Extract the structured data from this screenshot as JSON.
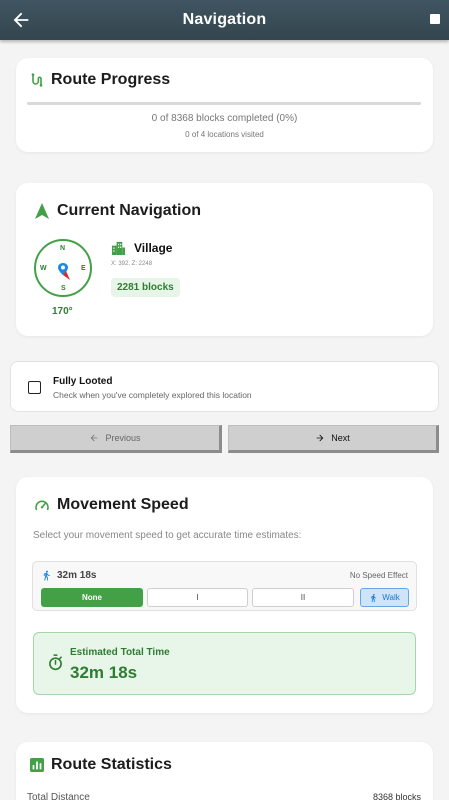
{
  "appbar": {
    "title": "Navigation"
  },
  "route_progress": {
    "title": "Route Progress",
    "progress_fraction": 0.0,
    "blocks_text": "0 of 8368 blocks completed (0%)",
    "locations_text": "0 of 4 locations visited"
  },
  "current_navigation": {
    "title": "Current Navigation",
    "compass": {
      "n": "N",
      "s": "S",
      "e": "E",
      "w": "W"
    },
    "heading": "170°",
    "location_name": "Village",
    "coords": "X: 392, Z: 2248",
    "distance": "2281 blocks"
  },
  "looted": {
    "title": "Fully Looted",
    "subtitle": "Check when you've completely explored this location",
    "checked": false
  },
  "nav_buttons": {
    "previous": "Previous",
    "next": "Next"
  },
  "movement_speed": {
    "title": "Movement Speed",
    "subtitle": "Select your movement speed to get accurate time estimates:",
    "time": "32m 18s",
    "effect": "No Speed Effect",
    "options": [
      "None",
      "I",
      "II"
    ],
    "walk_label": "Walk",
    "estimate_label": "Estimated Total Time",
    "estimate_value": "32m 18s"
  },
  "route_statistics": {
    "title": "Route Statistics",
    "total_distance_label": "Total Distance",
    "total_distance_value": "8368 blocks"
  },
  "colors": {
    "accent": "#43a047",
    "appbar": "#3f5561",
    "walk": "#1976d2"
  }
}
